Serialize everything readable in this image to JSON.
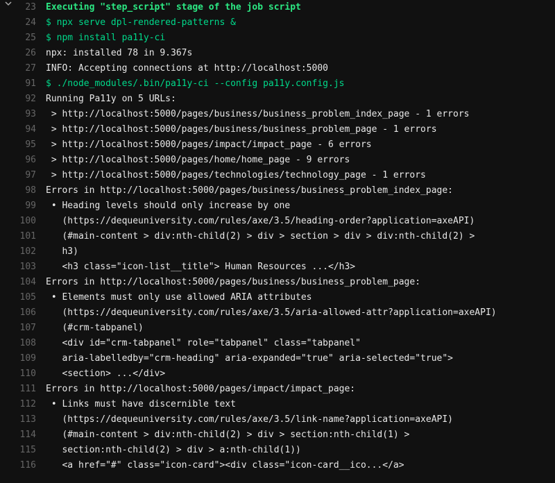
{
  "lines": [
    {
      "num": "23",
      "chevron": true,
      "class": "txt-bright-green",
      "text": "Executing \"step_script\" stage of the job script"
    },
    {
      "num": "24",
      "class": "txt-green",
      "text": "$ npx serve dpl-rendered-patterns &"
    },
    {
      "num": "25",
      "class": "txt-green",
      "text": "$ npm install pa11y-ci"
    },
    {
      "num": "26",
      "class": "txt-white",
      "text": "npx: installed 78 in 9.367s"
    },
    {
      "num": "27",
      "class": "txt-white",
      "text": "INFO: Accepting connections at http://localhost:5000"
    },
    {
      "num": "91",
      "class": "txt-green",
      "text": "$ ./node_modules/.bin/pa11y-ci --config pa11y.config.js"
    },
    {
      "num": "92",
      "class": "txt-white",
      "text": "Running Pa11y on 5 URLs:"
    },
    {
      "num": "93",
      "class": "txt-white",
      "text": " > http://localhost:5000/pages/business/business_problem_index_page - 1 errors"
    },
    {
      "num": "94",
      "class": "txt-white",
      "text": " > http://localhost:5000/pages/business/business_problem_page - 1 errors"
    },
    {
      "num": "95",
      "class": "txt-white",
      "text": " > http://localhost:5000/pages/impact/impact_page - 6 errors"
    },
    {
      "num": "96",
      "class": "txt-white",
      "text": " > http://localhost:5000/pages/home/home_page - 9 errors"
    },
    {
      "num": "97",
      "class": "txt-white",
      "text": " > http://localhost:5000/pages/technologies/technology_page - 1 errors"
    },
    {
      "num": "98",
      "class": "txt-white",
      "text": "Errors in http://localhost:5000/pages/business/business_problem_index_page:"
    },
    {
      "num": "99",
      "class": "txt-white",
      "text": " • Heading levels should only increase by one"
    },
    {
      "num": "100",
      "class": "txt-white",
      "text": "   (https://dequeuniversity.com/rules/axe/3.5/heading-order?application=axeAPI)"
    },
    {
      "num": "101",
      "class": "txt-white",
      "text": "   (#main-content > div:nth-child(2) > div > section > div > div:nth-child(2) >"
    },
    {
      "num": "102",
      "class": "txt-white",
      "text": "   h3)"
    },
    {
      "num": "103",
      "class": "txt-white",
      "text": "   <h3 class=\"icon-list__title\"> Human Resources ...</h3>"
    },
    {
      "num": "104",
      "class": "txt-white",
      "text": "Errors in http://localhost:5000/pages/business/business_problem_page:"
    },
    {
      "num": "105",
      "class": "txt-white",
      "text": " • Elements must only use allowed ARIA attributes"
    },
    {
      "num": "106",
      "class": "txt-white",
      "text": "   (https://dequeuniversity.com/rules/axe/3.5/aria-allowed-attr?application=axeAPI)"
    },
    {
      "num": "107",
      "class": "txt-white",
      "text": "   (#crm-tabpanel)"
    },
    {
      "num": "108",
      "class": "txt-white",
      "text": "   <div id=\"crm-tabpanel\" role=\"tabpanel\" class=\"tabpanel\""
    },
    {
      "num": "109",
      "class": "txt-white",
      "text": "   aria-labelledby=\"crm-heading\" aria-expanded=\"true\" aria-selected=\"true\">"
    },
    {
      "num": "110",
      "class": "txt-white",
      "text": "   <section> ...</div>"
    },
    {
      "num": "111",
      "class": "txt-white",
      "text": "Errors in http://localhost:5000/pages/impact/impact_page:"
    },
    {
      "num": "112",
      "class": "txt-white",
      "text": " • Links must have discernible text"
    },
    {
      "num": "113",
      "class": "txt-white",
      "text": "   (https://dequeuniversity.com/rules/axe/3.5/link-name?application=axeAPI)"
    },
    {
      "num": "114",
      "class": "txt-white",
      "text": "   (#main-content > div:nth-child(2) > div > section:nth-child(1) >"
    },
    {
      "num": "115",
      "class": "txt-white",
      "text": "   section:nth-child(2) > div > a:nth-child(1))"
    },
    {
      "num": "116",
      "class": "txt-white",
      "text": "   <a href=\"#\" class=\"icon-card\"><div class=\"icon-card__ico...</a>"
    }
  ]
}
